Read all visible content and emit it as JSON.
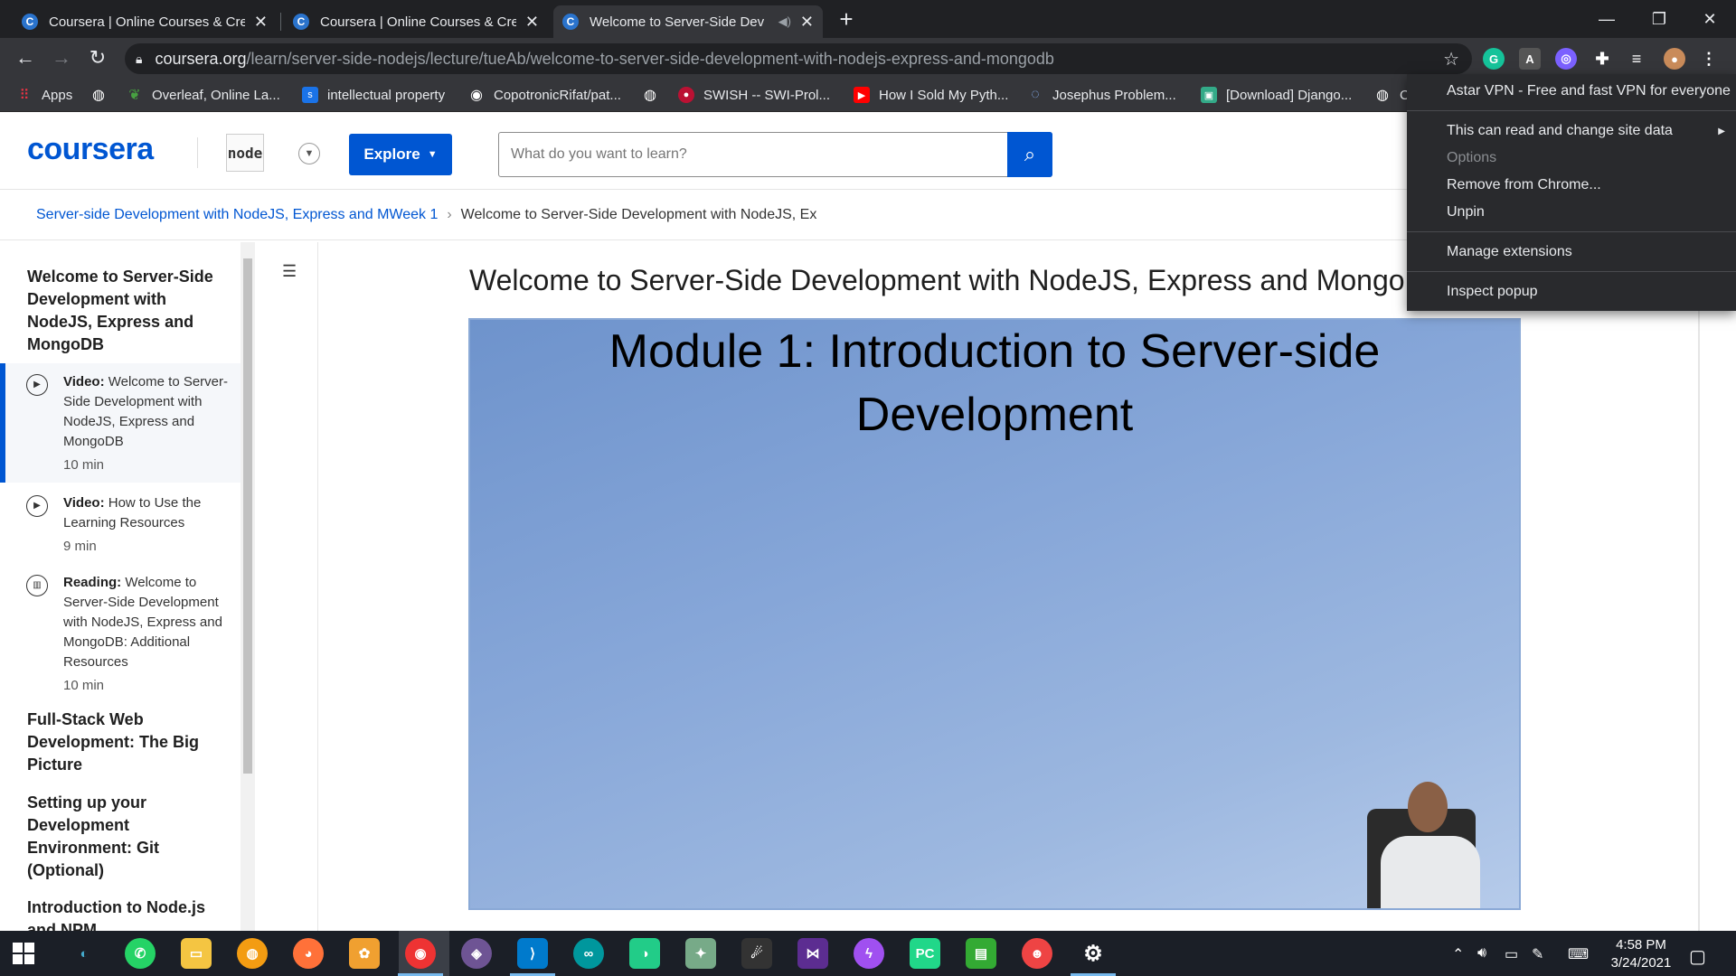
{
  "browser": {
    "tabs": [
      {
        "label": "Coursera | Online Courses & Cred",
        "favicon": "C",
        "active": false
      },
      {
        "label": "Coursera | Online Courses & Cred",
        "favicon": "C",
        "active": false
      },
      {
        "label": "Welcome to Server-Side Dev",
        "favicon": "C",
        "active": true
      }
    ],
    "url_host": "coursera.org",
    "url_path": "/learn/server-side-nodejs/lecture/tueAb/welcome-to-server-side-development-with-nodejs-express-and-mongodb",
    "bookmarks": [
      {
        "label": "Apps",
        "icon": "apps-grid-icon"
      },
      {
        "label": "",
        "icon": "globe-icon"
      },
      {
        "label": "Overleaf, Online La...",
        "icon": "overleaf-icon"
      },
      {
        "label": "intellectual property",
        "icon": "s-icon"
      },
      {
        "label": "CopotronicRifat/pat...",
        "icon": "github-icon"
      },
      {
        "label": "",
        "icon": "globe-icon"
      },
      {
        "label": "SWISH -- SWI-Prol...",
        "icon": "swish-icon"
      },
      {
        "label": "How I Sold My Pyth...",
        "icon": "youtube-icon"
      },
      {
        "label": "Josephus Problem...",
        "icon": "loading-icon"
      },
      {
        "label": "[Download] Django...",
        "icon": "image-icon"
      },
      {
        "label": "C",
        "icon": "globe-icon"
      }
    ]
  },
  "coursera": {
    "logo": "coursera",
    "partner_logo": "node",
    "explore_label": "Explore",
    "search_placeholder": "What do you want to learn?",
    "breadcrumb": {
      "link": "Server-side Development with NodeJS, Express and MWeek 1",
      "current": "Welcome to Server-Side Development with NodeJS, Ex"
    },
    "sidebar": {
      "week_title": "Welcome to Server-Side Development with NodeJS, Express and MongoDB",
      "items": [
        {
          "kind": "Video:",
          "title": "Welcome to Server-Side Development with NodeJS, Express and MongoDB",
          "duration": "10 min"
        },
        {
          "kind": "Video:",
          "title": "How to Use the Learning Resources",
          "duration": "9 min"
        },
        {
          "kind": "Reading:",
          "title": "Welcome to Server-Side Development with NodeJS, Express and MongoDB: Additional Resources",
          "duration": "10 min"
        }
      ],
      "sections": [
        "Full-Stack Web Development: The Big Picture",
        "Setting up your Development Environment: Git (Optional)",
        "Introduction to Node.js and NPM"
      ]
    },
    "video_title": "Welcome to Server-Side Development with NodeJS, Express and MongoDB",
    "slide_title_line1": "Module 1: Introduction to Server-side",
    "slide_title_line2": "Development"
  },
  "ext_menu": {
    "title": "Astar VPN - Free and fast VPN for everyone",
    "site_data": "This can read and change site data",
    "options": "Options",
    "remove": "Remove from Chrome...",
    "unpin": "Unpin",
    "manage": "Manage extensions",
    "inspect": "Inspect popup"
  },
  "taskbar": {
    "time": "4:58 PM",
    "date": "3/24/2021"
  }
}
